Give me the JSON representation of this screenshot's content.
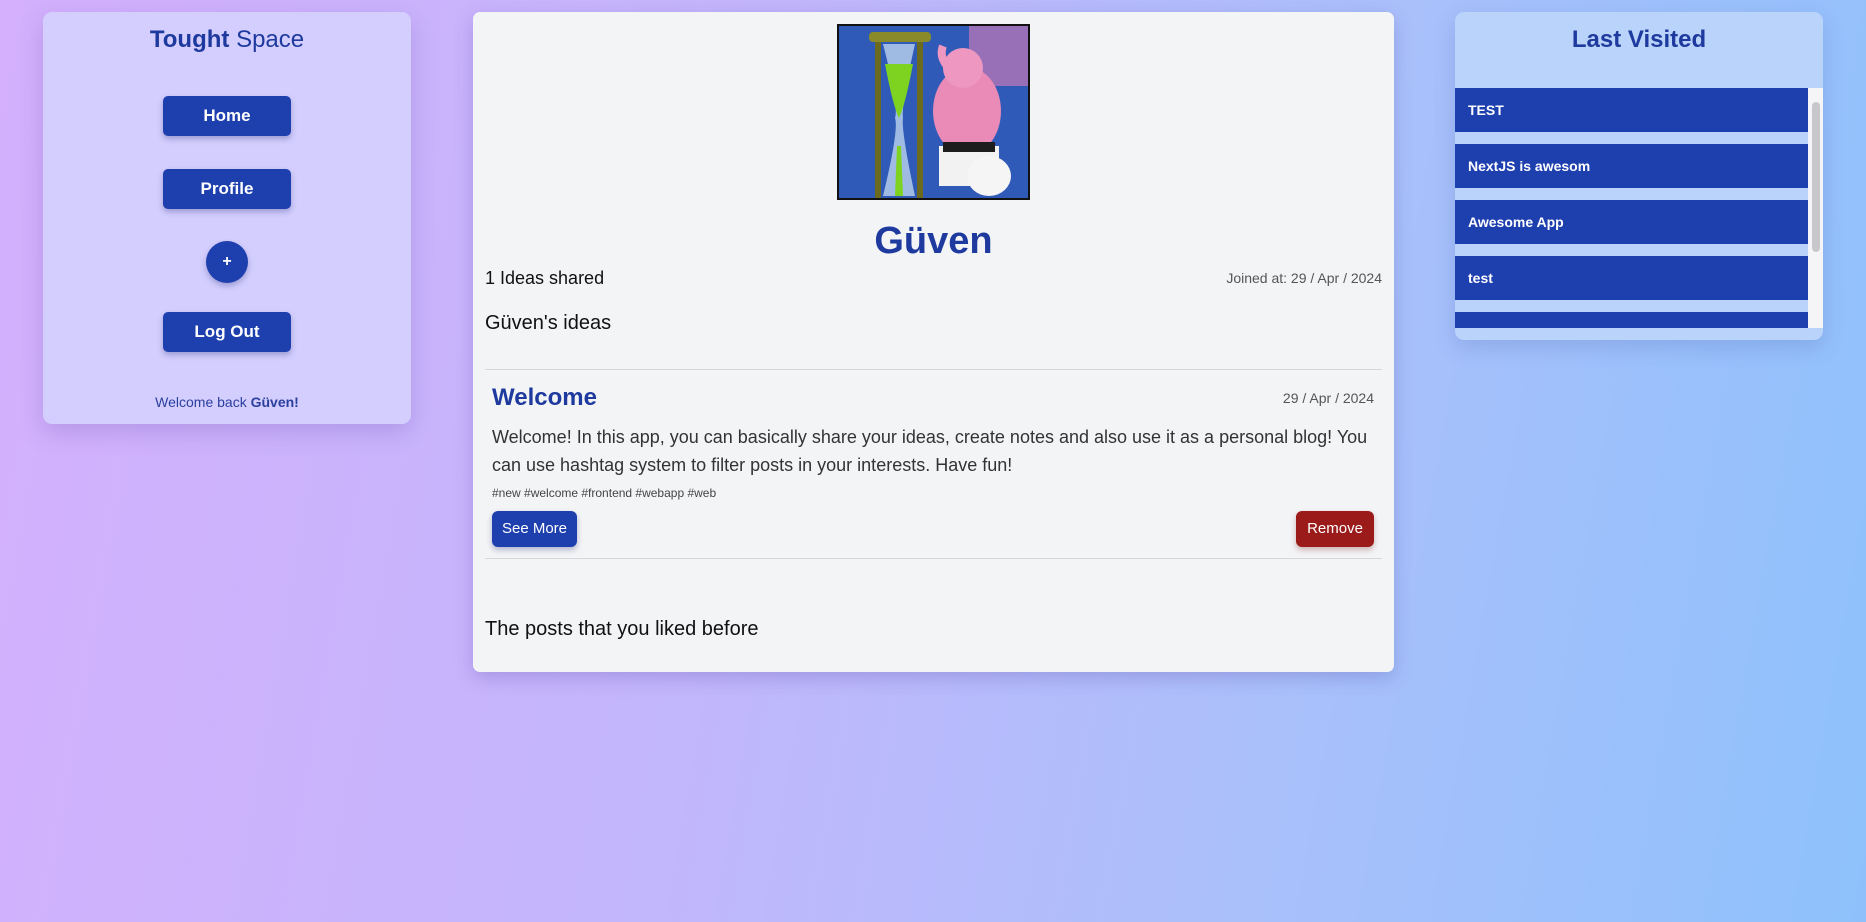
{
  "sidebar": {
    "brand_bold": "Tought",
    "brand_light": "Space",
    "home_label": "Home",
    "profile_label": "Profile",
    "add_label": "+",
    "logout_label": "Log Out",
    "welcome_prefix": "Welcome back",
    "welcome_name": "Güven!"
  },
  "profile": {
    "username": "Güven",
    "ideas_count": "1 Ideas shared",
    "joined": "Joined at: 29 / Apr / 2024",
    "ideas_heading": "Güven's ideas",
    "liked_heading": "The posts that you liked before"
  },
  "post": {
    "title": "Welcome",
    "date": "29 / Apr / 2024",
    "body": "Welcome! In this app, you can basically share your ideas, create notes and also use it as a personal blog! You can use hashtag system to filter posts in your interests. Have fun!",
    "tags": "#new #welcome #frontend #webapp #web",
    "see_more_label": "See More",
    "remove_label": "Remove"
  },
  "last_visited": {
    "title": "Last Visited",
    "items": [
      "TEST",
      "NextJS is awesom",
      "Awesome App",
      "test",
      ""
    ]
  },
  "colors": {
    "primary": "#1e3fae",
    "danger": "#9b1b1b",
    "heading": "#1e3a9e"
  }
}
